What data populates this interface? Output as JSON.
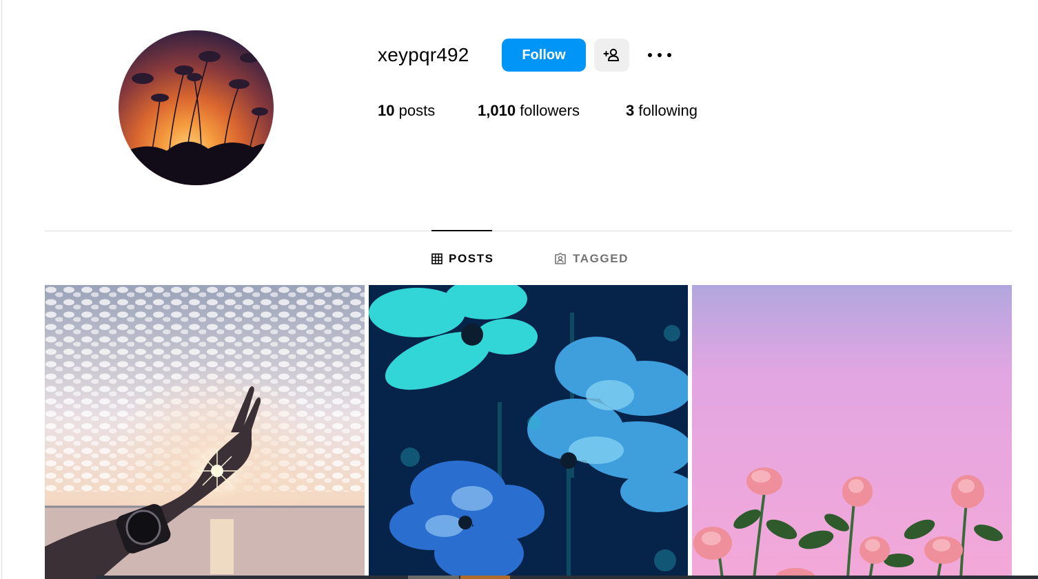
{
  "profile": {
    "username": "xeypqr492",
    "follow_label": "Follow",
    "add_user_icon": "add-user-icon",
    "more_icon": "more-options-icon"
  },
  "stats": {
    "posts_count": "10",
    "posts_label": "posts",
    "followers_count": "1,010",
    "followers_label": "followers",
    "following_count": "3",
    "following_label": "following"
  },
  "tabs": [
    {
      "label": "POSTS",
      "icon": "grid-icon",
      "active": true
    },
    {
      "label": "TAGGED",
      "icon": "tagged-user-icon",
      "active": false
    }
  ],
  "colors": {
    "accent": "#0095f6",
    "secondary_button": "#efefef",
    "divider": "#dbdbdb",
    "muted_text": "#737373"
  }
}
